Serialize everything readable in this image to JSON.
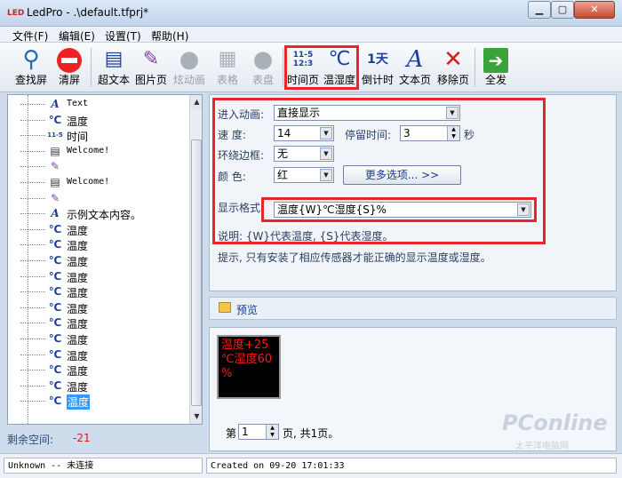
{
  "window": {
    "app_icon": "LED",
    "title": "LedPro - .\\default.tfprj*",
    "min_glyph": "▁",
    "max_glyph": "▢",
    "close_glyph": "✕"
  },
  "menu": [
    "文件(F)",
    "编辑(E)",
    "设置(T)",
    "帮助(H)"
  ],
  "toolbar": {
    "items": [
      {
        "label": "查找屏",
        "icon": "magnifier-icon",
        "glyph": "🔍",
        "enabled": true
      },
      {
        "label": "清屏",
        "icon": "clear-screen-icon",
        "glyph": "⛔",
        "enabled": true
      },
      {
        "label": "超文本",
        "icon": "hypertext-icon",
        "glyph": "📝",
        "enabled": true
      },
      {
        "label": "图片页",
        "icon": "picture-page-icon",
        "glyph": "🖍",
        "enabled": true
      },
      {
        "label": "炫动画",
        "icon": "animation-icon",
        "glyph": "●",
        "enabled": false
      },
      {
        "label": "表格",
        "icon": "table-icon",
        "glyph": "▦",
        "enabled": false
      },
      {
        "label": "表盘",
        "icon": "dial-icon",
        "glyph": "●",
        "enabled": false
      },
      {
        "label": "时间页",
        "icon": "time-page-icon",
        "glyph": "11-5\n12:3",
        "enabled": true
      },
      {
        "label": "温湿度",
        "icon": "temperature-humidity-icon",
        "glyph": "℃",
        "enabled": true
      },
      {
        "label": "倒计时",
        "icon": "countdown-icon",
        "glyph": "1天",
        "enabled": true
      },
      {
        "label": "文本页",
        "icon": "text-page-icon",
        "glyph": "A",
        "enabled": true
      },
      {
        "label": "移除页",
        "icon": "remove-page-icon",
        "glyph": "✕",
        "enabled": true
      },
      {
        "label": "全发",
        "icon": "send-all-icon",
        "glyph": "➔",
        "enabled": true
      }
    ]
  },
  "tree": {
    "items": [
      {
        "icon": "text-icon",
        "glyph": "A",
        "label": "Text",
        "mono": true
      },
      {
        "icon": "temperature-icon",
        "glyph": "℃",
        "label": "温度"
      },
      {
        "icon": "time-icon",
        "glyph": "11-5",
        "label": "时间"
      },
      {
        "icon": "hypertext-icon",
        "glyph": "▤",
        "label": "Welcome!",
        "mono": true
      },
      {
        "icon": "picture-icon",
        "glyph": "✎",
        "label": ""
      },
      {
        "icon": "hypertext-icon",
        "glyph": "▤",
        "label": "Welcome!",
        "mono": true
      },
      {
        "icon": "picture-icon",
        "glyph": "✎",
        "label": ""
      },
      {
        "icon": "text-icon",
        "glyph": "A",
        "label": "示例文本内容。"
      },
      {
        "icon": "temperature-icon",
        "glyph": "℃",
        "label": "温度"
      },
      {
        "icon": "temperature-icon",
        "glyph": "℃",
        "label": "温度"
      },
      {
        "icon": "temperature-icon",
        "glyph": "℃",
        "label": "温度"
      },
      {
        "icon": "temperature-icon",
        "glyph": "℃",
        "label": "温度"
      },
      {
        "icon": "temperature-icon",
        "glyph": "℃",
        "label": "温度"
      },
      {
        "icon": "temperature-icon",
        "glyph": "℃",
        "label": "温度"
      },
      {
        "icon": "temperature-icon",
        "glyph": "℃",
        "label": "温度"
      },
      {
        "icon": "temperature-icon",
        "glyph": "℃",
        "label": "温度"
      },
      {
        "icon": "temperature-icon",
        "glyph": "℃",
        "label": "温度"
      },
      {
        "icon": "temperature-icon",
        "glyph": "℃",
        "label": "温度"
      },
      {
        "icon": "temperature-icon",
        "glyph": "℃",
        "label": "温度"
      },
      {
        "icon": "temperature-icon",
        "glyph": "℃",
        "label": "温度",
        "selected": true
      }
    ]
  },
  "space": {
    "label": "剩余空间:",
    "value": "-21"
  },
  "settings": {
    "entry_anim_label": "进入动画:",
    "entry_anim_value": "直接显示",
    "speed_label": "速    度:",
    "speed_value": "14",
    "stay_label": "停留时间:",
    "stay_value": "3",
    "stay_unit": "秒",
    "border_label": "环绕边框:",
    "border_value": "无",
    "color_label": "颜    色:",
    "color_value": "红",
    "more_button": "更多选项...  >>",
    "format_label": "显示格式:",
    "format_value": "温度{W}℃湿度{S}%",
    "note": "说明: {W}代表温度, {S}代表湿度。",
    "hint": "提示, 只有安装了相应传感器才能正确的显示温度或湿度。"
  },
  "preview": {
    "header": "预览",
    "led_lines": [
      "温度+25",
      "℃湿度60",
      "%"
    ],
    "page_prefix": "第",
    "page_value": "1",
    "page_suffix": "页, 共1页。"
  },
  "status": {
    "connection": "Unknown -- 未连接",
    "created": "Created on 09-20 17:01:33"
  },
  "watermark": {
    "main": "PConline",
    "sub": "太平洋电脑网"
  },
  "colors": {
    "highlight": "#e8262a",
    "accent": "#3399ff",
    "led": "#ff1a1a"
  }
}
